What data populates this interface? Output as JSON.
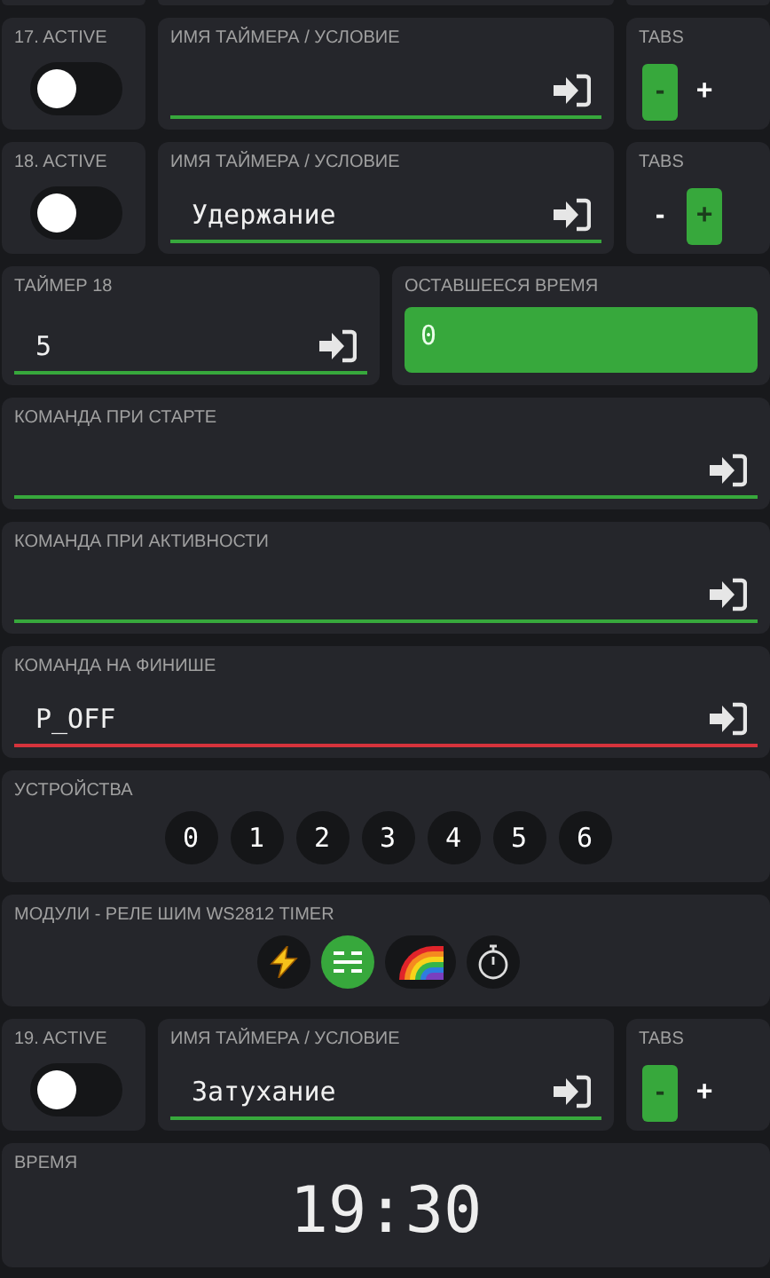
{
  "sections": [
    {
      "kind": "timer_row",
      "active": {
        "label": "17. ACTIVE",
        "on": false
      },
      "name": {
        "label": "ИМЯ ТАЙМЕРА / УСЛОВИЕ",
        "invalid": false
      },
      "tabs": {
        "label": "TABS",
        "buttons": [
          {
            "label": "-",
            "selected": true
          },
          {
            "label": "+",
            "selected": false
          }
        ]
      }
    },
    {
      "kind": "timer_row",
      "active": {
        "label": "18. ACTIVE",
        "on": false
      },
      "name": {
        "label": "ИМЯ ТАЙМЕРА / УСЛОВИЕ",
        "value": "Удержание",
        "invalid": false
      },
      "tabs": {
        "label": "TABS",
        "buttons": [
          {
            "label": "-",
            "selected": false
          },
          {
            "label": "+",
            "selected": true
          }
        ]
      }
    },
    {
      "kind": "timer_value",
      "timer": {
        "label": "ТАЙМЕР 18",
        "value": "5",
        "invalid": false
      },
      "remaining": {
        "label": "ОСТАВШЕЕСЯ ВРЕМЯ",
        "value": "0"
      }
    },
    {
      "kind": "command",
      "label": "КОМАНДА ПРИ СТАРТЕ",
      "invalid": false
    },
    {
      "kind": "command",
      "label": "КОМАНДА ПРИ АКТИВНОСТИ",
      "invalid": false
    },
    {
      "kind": "command",
      "label": "КОМАНДА НА ФИНИШЕ",
      "value": "P_OFF",
      "invalid": true
    },
    {
      "kind": "devices",
      "label": "УСТРОЙСТВА",
      "buttons": [
        {
          "label": "0",
          "selected": false
        },
        {
          "label": "1",
          "selected": false
        },
        {
          "label": "2",
          "selected": false
        },
        {
          "label": "3",
          "selected": false
        },
        {
          "label": "4",
          "selected": false
        },
        {
          "label": "5",
          "selected": false
        },
        {
          "label": "6",
          "selected": false
        }
      ]
    },
    {
      "kind": "modules",
      "label": "МОДУЛИ - РЕЛЕ ШИМ WS2812 TIMER",
      "buttons": [
        {
          "kind": "bolt",
          "selected": false
        },
        {
          "kind": "sliders",
          "selected": true
        },
        {
          "kind": "rainbow",
          "selected": false
        },
        {
          "kind": "stopwatch",
          "selected": false
        }
      ]
    },
    {
      "kind": "timer_row",
      "active": {
        "label": "19. ACTIVE",
        "on": false
      },
      "name": {
        "label": "ИМЯ ТАЙМЕРА / УСЛОВИЕ",
        "value": "Затухание",
        "invalid": false
      },
      "tabs": {
        "label": "TABS",
        "buttons": [
          {
            "label": "-",
            "selected": true
          },
          {
            "label": "+",
            "selected": false
          }
        ]
      }
    },
    {
      "kind": "time",
      "label": "ВРЕМЯ",
      "value": "19:30"
    }
  ]
}
